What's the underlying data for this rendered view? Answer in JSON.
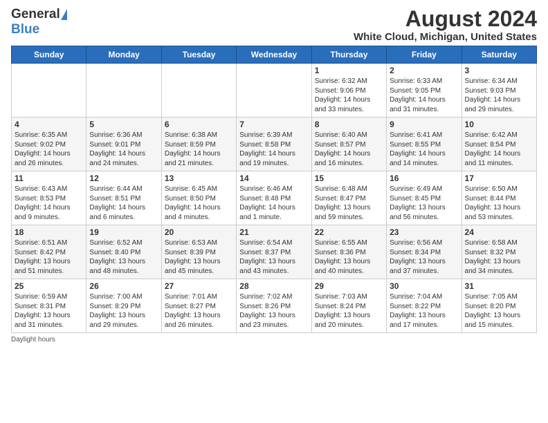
{
  "header": {
    "logo_general": "General",
    "logo_blue": "Blue",
    "title": "August 2024",
    "subtitle": "White Cloud, Michigan, United States"
  },
  "weekdays": [
    "Sunday",
    "Monday",
    "Tuesday",
    "Wednesday",
    "Thursday",
    "Friday",
    "Saturday"
  ],
  "weeks": [
    [
      {
        "day": "",
        "detail": ""
      },
      {
        "day": "",
        "detail": ""
      },
      {
        "day": "",
        "detail": ""
      },
      {
        "day": "",
        "detail": ""
      },
      {
        "day": "1",
        "detail": "Sunrise: 6:32 AM\nSunset: 9:06 PM\nDaylight: 14 hours\nand 33 minutes."
      },
      {
        "day": "2",
        "detail": "Sunrise: 6:33 AM\nSunset: 9:05 PM\nDaylight: 14 hours\nand 31 minutes."
      },
      {
        "day": "3",
        "detail": "Sunrise: 6:34 AM\nSunset: 9:03 PM\nDaylight: 14 hours\nand 29 minutes."
      }
    ],
    [
      {
        "day": "4",
        "detail": "Sunrise: 6:35 AM\nSunset: 9:02 PM\nDaylight: 14 hours\nand 26 minutes."
      },
      {
        "day": "5",
        "detail": "Sunrise: 6:36 AM\nSunset: 9:01 PM\nDaylight: 14 hours\nand 24 minutes."
      },
      {
        "day": "6",
        "detail": "Sunrise: 6:38 AM\nSunset: 8:59 PM\nDaylight: 14 hours\nand 21 minutes."
      },
      {
        "day": "7",
        "detail": "Sunrise: 6:39 AM\nSunset: 8:58 PM\nDaylight: 14 hours\nand 19 minutes."
      },
      {
        "day": "8",
        "detail": "Sunrise: 6:40 AM\nSunset: 8:57 PM\nDaylight: 14 hours\nand 16 minutes."
      },
      {
        "day": "9",
        "detail": "Sunrise: 6:41 AM\nSunset: 8:55 PM\nDaylight: 14 hours\nand 14 minutes."
      },
      {
        "day": "10",
        "detail": "Sunrise: 6:42 AM\nSunset: 8:54 PM\nDaylight: 14 hours\nand 11 minutes."
      }
    ],
    [
      {
        "day": "11",
        "detail": "Sunrise: 6:43 AM\nSunset: 8:53 PM\nDaylight: 14 hours\nand 9 minutes."
      },
      {
        "day": "12",
        "detail": "Sunrise: 6:44 AM\nSunset: 8:51 PM\nDaylight: 14 hours\nand 6 minutes."
      },
      {
        "day": "13",
        "detail": "Sunrise: 6:45 AM\nSunset: 8:50 PM\nDaylight: 14 hours\nand 4 minutes."
      },
      {
        "day": "14",
        "detail": "Sunrise: 6:46 AM\nSunset: 8:48 PM\nDaylight: 14 hours\nand 1 minute."
      },
      {
        "day": "15",
        "detail": "Sunrise: 6:48 AM\nSunset: 8:47 PM\nDaylight: 13 hours\nand 59 minutes."
      },
      {
        "day": "16",
        "detail": "Sunrise: 6:49 AM\nSunset: 8:45 PM\nDaylight: 13 hours\nand 56 minutes."
      },
      {
        "day": "17",
        "detail": "Sunrise: 6:50 AM\nSunset: 8:44 PM\nDaylight: 13 hours\nand 53 minutes."
      }
    ],
    [
      {
        "day": "18",
        "detail": "Sunrise: 6:51 AM\nSunset: 8:42 PM\nDaylight: 13 hours\nand 51 minutes."
      },
      {
        "day": "19",
        "detail": "Sunrise: 6:52 AM\nSunset: 8:40 PM\nDaylight: 13 hours\nand 48 minutes."
      },
      {
        "day": "20",
        "detail": "Sunrise: 6:53 AM\nSunset: 8:39 PM\nDaylight: 13 hours\nand 45 minutes."
      },
      {
        "day": "21",
        "detail": "Sunrise: 6:54 AM\nSunset: 8:37 PM\nDaylight: 13 hours\nand 43 minutes."
      },
      {
        "day": "22",
        "detail": "Sunrise: 6:55 AM\nSunset: 8:36 PM\nDaylight: 13 hours\nand 40 minutes."
      },
      {
        "day": "23",
        "detail": "Sunrise: 6:56 AM\nSunset: 8:34 PM\nDaylight: 13 hours\nand 37 minutes."
      },
      {
        "day": "24",
        "detail": "Sunrise: 6:58 AM\nSunset: 8:32 PM\nDaylight: 13 hours\nand 34 minutes."
      }
    ],
    [
      {
        "day": "25",
        "detail": "Sunrise: 6:59 AM\nSunset: 8:31 PM\nDaylight: 13 hours\nand 31 minutes."
      },
      {
        "day": "26",
        "detail": "Sunrise: 7:00 AM\nSunset: 8:29 PM\nDaylight: 13 hours\nand 29 minutes."
      },
      {
        "day": "27",
        "detail": "Sunrise: 7:01 AM\nSunset: 8:27 PM\nDaylight: 13 hours\nand 26 minutes."
      },
      {
        "day": "28",
        "detail": "Sunrise: 7:02 AM\nSunset: 8:26 PM\nDaylight: 13 hours\nand 23 minutes."
      },
      {
        "day": "29",
        "detail": "Sunrise: 7:03 AM\nSunset: 8:24 PM\nDaylight: 13 hours\nand 20 minutes."
      },
      {
        "day": "30",
        "detail": "Sunrise: 7:04 AM\nSunset: 8:22 PM\nDaylight: 13 hours\nand 17 minutes."
      },
      {
        "day": "31",
        "detail": "Sunrise: 7:05 AM\nSunset: 8:20 PM\nDaylight: 13 hours\nand 15 minutes."
      }
    ]
  ],
  "footer": "Daylight hours"
}
